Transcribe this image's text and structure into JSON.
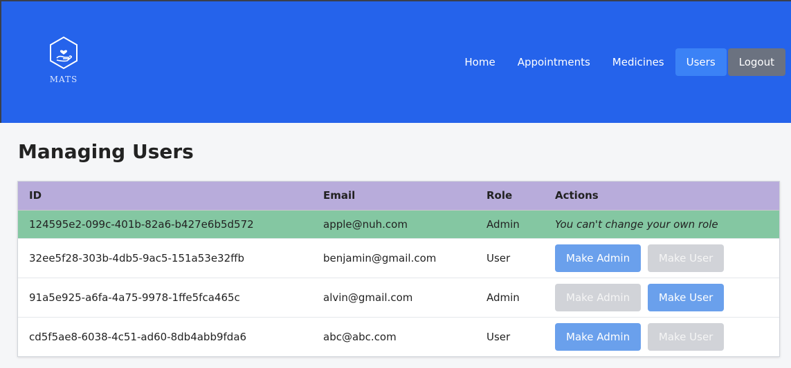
{
  "app": {
    "logo_text": "MATS"
  },
  "nav": {
    "items": [
      {
        "label": "Home"
      },
      {
        "label": "Appointments"
      },
      {
        "label": "Medicines"
      },
      {
        "label": "Users"
      }
    ],
    "active": "Users",
    "logout_label": "Logout"
  },
  "page": {
    "title": "Managing Users"
  },
  "table": {
    "headers": [
      "ID",
      "Email",
      "Role",
      "Actions"
    ],
    "rows": [
      {
        "id": "124595e2-099c-401b-82a6-b427e6b5d572",
        "email": "apple@nuh.com",
        "role": "Admin",
        "note": "You can't change your own role"
      },
      {
        "id": "32ee5f28-303b-4db5-9ac5-151a53e32ffb",
        "email": "benjamin@gmail.com",
        "role": "User",
        "make_admin_label": "Make Admin",
        "make_user_label": "Make User",
        "make_admin_enabled": true,
        "make_user_enabled": false
      },
      {
        "id": "91a5e925-a6fa-4a75-9978-1ffe5fca465c",
        "email": "alvin@gmail.com",
        "role": "Admin",
        "make_admin_label": "Make Admin",
        "make_user_label": "Make User",
        "make_admin_enabled": false,
        "make_user_enabled": true
      },
      {
        "id": "cd5f5ae8-6038-4c51-ad60-8db4abb9fda6",
        "email": "abc@abc.com",
        "role": "User",
        "make_admin_label": "Make Admin",
        "make_user_label": "Make User",
        "make_admin_enabled": true,
        "make_user_enabled": false
      }
    ]
  },
  "colors": {
    "navbar": "#2563eb",
    "active_nav": "#3b82f6",
    "logout": "#6b7280",
    "header_row": "#b8acdb",
    "self_row": "#84c7a2",
    "button_enabled": "#6aa0ec",
    "button_disabled": "#d1d3d8"
  }
}
